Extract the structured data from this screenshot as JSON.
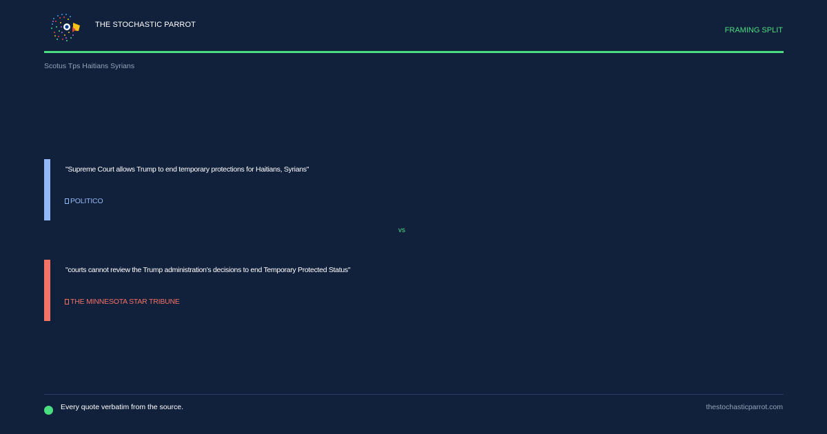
{
  "header": {
    "brand": "THE STOCHASTIC PARROT",
    "badge": "FRAMING SPLIT",
    "accent_color": "#4ade80",
    "logo": "parrot-logo-icon"
  },
  "topic": "Scotus Tps Haitians Syrians",
  "quotes": [
    {
      "text": "\"Supreme Court allows Trump to end temporary protections for Haitians, Syrians\"",
      "source": "POLITICO",
      "source_icon": "document-icon",
      "color": "#93b8f7"
    },
    {
      "text": "\"courts cannot review the Trump administration's decisions to end Temporary Protected Status\"",
      "source": "THE MINNESOTA STAR TRIBUNE",
      "source_icon": "document-icon",
      "color": "#f47266"
    }
  ],
  "separator": "vs",
  "footer": {
    "note": "Every quote verbatim from the source.",
    "url": "thestochasticparrot.com"
  }
}
